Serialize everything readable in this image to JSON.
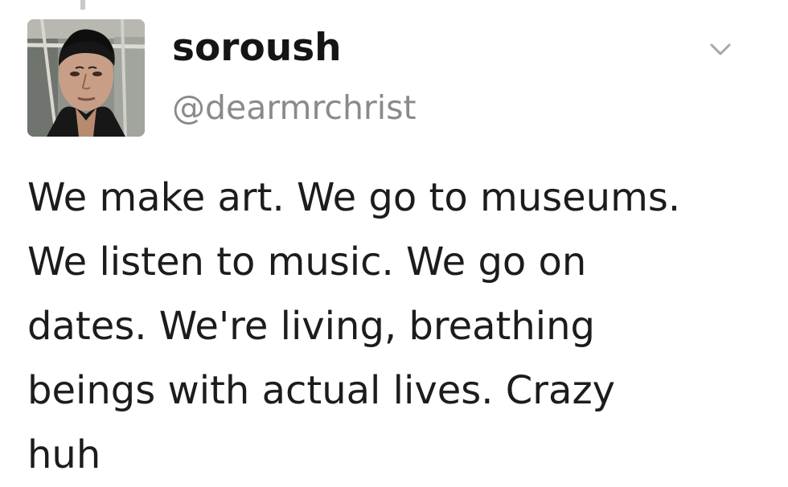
{
  "tweet": {
    "author": {
      "display_name": "soroush",
      "username": "@dearmrchrist"
    },
    "avatar_icon": "profile-photo",
    "menu_icon": "chevron-down-icon",
    "text": "We make art. We go to museums.\nWe listen to music. We go on\ndates. We're living, breathing\nbeings with actual lives. Crazy\nhuh"
  }
}
